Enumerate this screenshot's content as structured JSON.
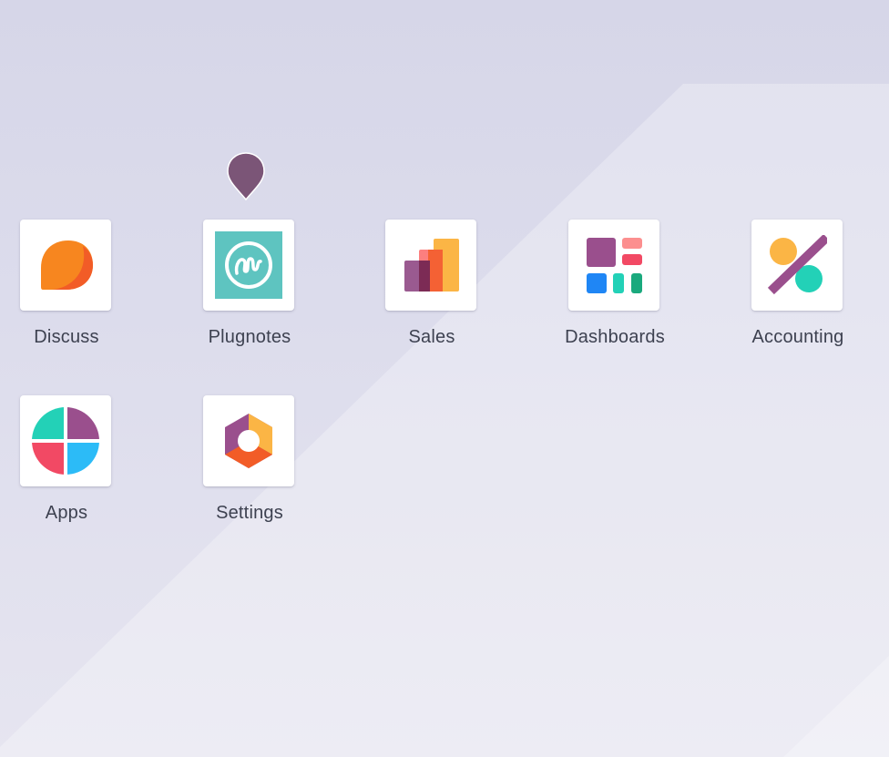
{
  "colors": {
    "label_text": "#3d4150",
    "tile_bg": "#ffffff",
    "pin": "#7b5577"
  },
  "apps": [
    {
      "label": "Discuss",
      "icon": "discuss-icon"
    },
    {
      "label": "Plugnotes",
      "icon": "plugnotes-icon"
    },
    {
      "label": "Sales",
      "icon": "sales-icon"
    },
    {
      "label": "Dashboards",
      "icon": "dashboards-icon"
    },
    {
      "label": "Accounting",
      "icon": "accounting-icon"
    },
    {
      "label": "Apps",
      "icon": "apps-icon"
    },
    {
      "label": "Settings",
      "icon": "settings-icon"
    }
  ],
  "pin": {
    "icon": "map-pin-icon"
  }
}
